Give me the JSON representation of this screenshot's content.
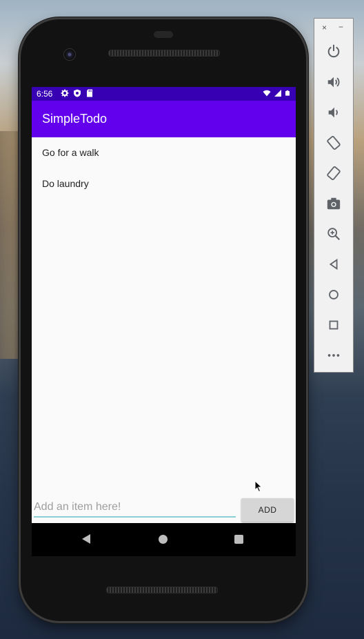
{
  "status_bar": {
    "time": "6:56",
    "icons_left": [
      "settings-icon",
      "shield-icon",
      "sd-card-icon"
    ],
    "icons_right": [
      "wifi-icon",
      "signal-icon",
      "battery-icon"
    ]
  },
  "app": {
    "title": "SimpleTodo",
    "items": [
      {
        "label": "Go for a walk"
      },
      {
        "label": "Do laundry"
      }
    ],
    "input": {
      "value": "",
      "placeholder": "Add an item here!"
    },
    "add_button_label": "ADD"
  },
  "nav_bar": {
    "buttons": [
      "back-icon",
      "home-icon",
      "recents-icon"
    ]
  },
  "emulator_toolbar": {
    "window_controls": {
      "close": "×",
      "minimize": "−"
    },
    "buttons": [
      "power-icon",
      "volume-up-icon",
      "volume-down-icon",
      "rotate-left-icon",
      "rotate-right-icon",
      "screenshot-icon",
      "zoom-icon",
      "back-icon",
      "home-icon",
      "overview-icon",
      "more-icon"
    ]
  },
  "colors": {
    "status_bar": "#3700b3",
    "app_bar": "#6200ee",
    "input_underline": "#8bcfd6",
    "add_button": "#d6d6d6"
  }
}
